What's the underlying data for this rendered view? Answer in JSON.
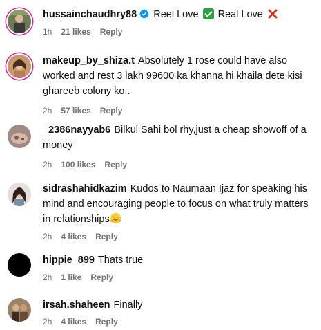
{
  "comments": [
    {
      "username": "hussainchaudhry88",
      "text_a": "Reel Love",
      "text_b": "Real Love",
      "time": "1h",
      "likes": "21 likes",
      "reply": "Reply"
    },
    {
      "username": "makeup_by_shiza.t",
      "text": "Absolutely 1 rose could have also worked and rest 3 lakh 99600 ka khanna hi khaila dete kisi ghareeb colony ko..",
      "time": "2h",
      "likes": "57 likes",
      "reply": "Reply"
    },
    {
      "username": "_2386nayyab6",
      "text": "Bilkul Sahi bol rhy,just a cheap showoff of a money",
      "time": "2h",
      "likes": "100 likes",
      "reply": "Reply"
    },
    {
      "username": "sidrashahidkazim",
      "text": "Kudos to Naumaan Ijaz for speaking his mind and encouraging people to focus on what truly matters in relationships",
      "time": "2h",
      "likes": "4 likes",
      "reply": "Reply"
    },
    {
      "username": "hippie_899",
      "text": "Thats true",
      "time": "2h",
      "likes": "1 like",
      "reply": "Reply"
    },
    {
      "username": "irsah.shaheen",
      "text": "Finally",
      "time": "2h",
      "likes": "4 likes",
      "reply": "Reply"
    }
  ]
}
